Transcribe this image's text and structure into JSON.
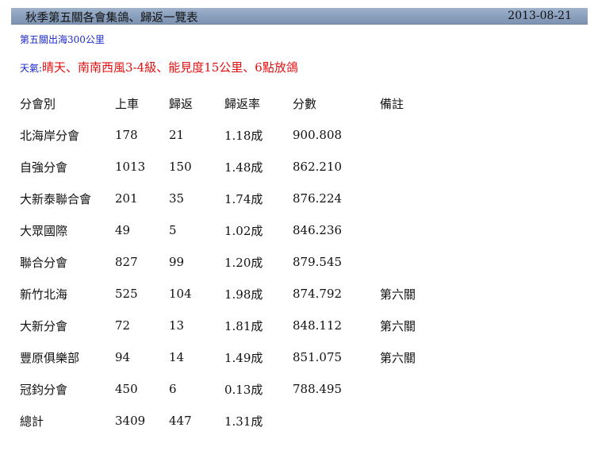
{
  "header": {
    "title": "秋季第五關各會集鴿、歸返一覽表",
    "date": "2013-08-21"
  },
  "subtitle": "第五關出海300公里",
  "weather": {
    "label": "天氣:",
    "text": "晴天、南南西風3-4級、能見度15公里、6點放鴿"
  },
  "table": {
    "columns": [
      "分會別",
      "上車",
      "歸返",
      "歸返率",
      "分數",
      "備註"
    ],
    "rows": [
      [
        "北海岸分會",
        "178",
        "21",
        "1.18成",
        "900.808",
        ""
      ],
      [
        "自強分會",
        "1013",
        "150",
        "1.48成",
        "862.210",
        ""
      ],
      [
        "大新泰聯合會",
        "201",
        "35",
        "1.74成",
        "876.224",
        ""
      ],
      [
        "大眾國際",
        "49",
        "5",
        "1.02成",
        "846.236",
        ""
      ],
      [
        "聯合分會",
        "827",
        "99",
        "1.20成",
        "879.545",
        ""
      ],
      [
        "新竹北海",
        "525",
        "104",
        "1.98成",
        "874.792",
        "第六關"
      ],
      [
        "大新分會",
        "72",
        "13",
        "1.81成",
        "848.112",
        "第六關"
      ],
      [
        "豐原俱樂部",
        "94",
        "14",
        "1.49成",
        "851.075",
        "第六關"
      ],
      [
        "冠鈞分會",
        "450",
        "6",
        "0.13成",
        "788.495",
        ""
      ],
      [
        "總計",
        "3409",
        "447",
        "1.31成",
        "",
        ""
      ]
    ]
  },
  "colors": {
    "header_bar": "#8aa0bd",
    "subtitle": "#1a28c8",
    "weather": "#e01010"
  }
}
